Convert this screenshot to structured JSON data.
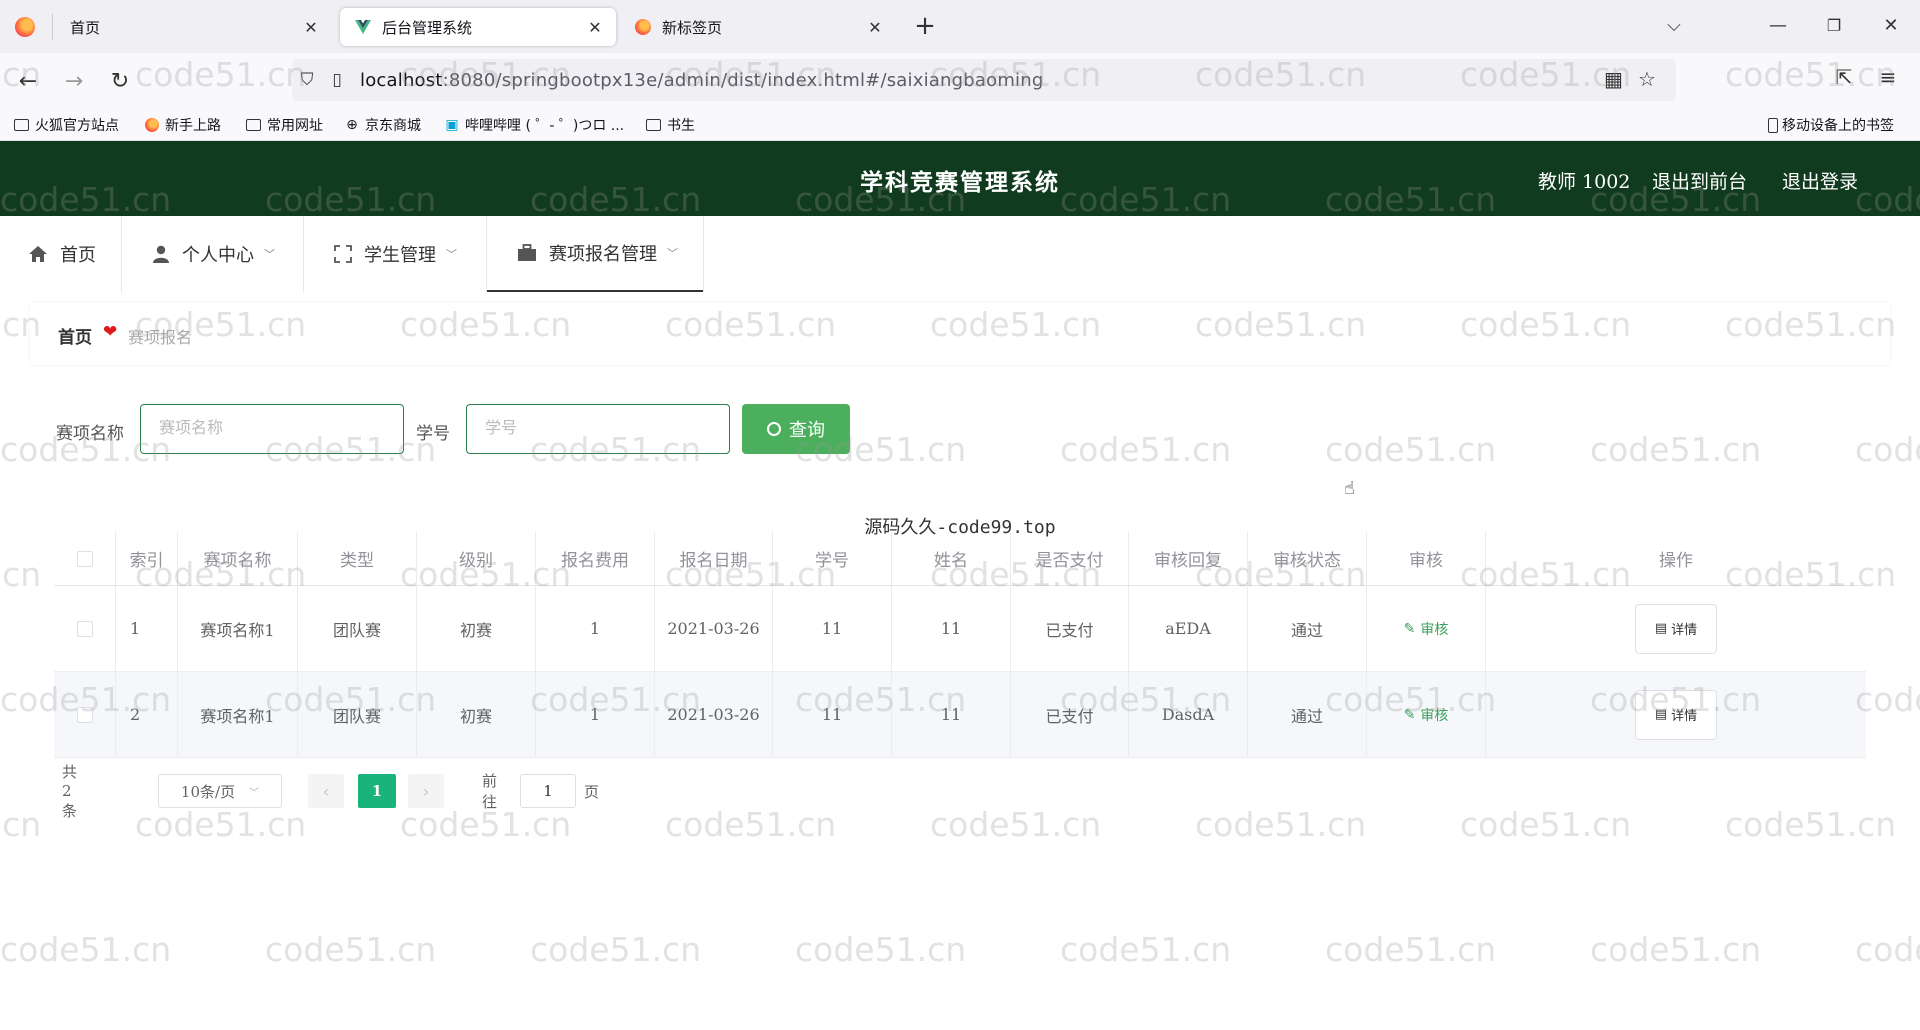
{
  "browser": {
    "tabs": [
      {
        "title": "首页",
        "close": "✕",
        "icon": "firefox-icon"
      },
      {
        "title": "后台管理系统",
        "close": "✕",
        "icon": "vue-icon"
      },
      {
        "title": "新标签页",
        "close": "✕",
        "icon": "firefox-icon"
      }
    ],
    "new_tab": "+",
    "url_host": "localhost",
    "url_rest": ":8080/springbootpx13e/admin/dist/index.html#/saixiangbaoming",
    "bookmarks": [
      {
        "label": "火狐官方站点",
        "icon": "folder-icon"
      },
      {
        "label": "新手上路",
        "icon": "firefox-icon"
      },
      {
        "label": "常用网址",
        "icon": "folder-icon"
      },
      {
        "label": "京东商城",
        "icon": "globe-icon"
      },
      {
        "label": "哔哩哔哩 ( ゜- ゜)つロ ...",
        "icon": "bilibili-icon"
      },
      {
        "label": "书生",
        "icon": "folder-icon"
      }
    ],
    "mobile_bookmarks": "移动设备上的书签"
  },
  "header": {
    "title": "学科竞赛管理系统",
    "user": "教师 1002",
    "to_front": "退出到前台",
    "logout": "退出登录"
  },
  "menu": [
    {
      "label": "首页",
      "icon": "home-icon"
    },
    {
      "label": "个人中心",
      "icon": "user-icon"
    },
    {
      "label": "学生管理",
      "icon": "frame-icon"
    },
    {
      "label": "赛项报名管理",
      "icon": "briefcase-icon"
    }
  ],
  "breadcrumb": {
    "home": "首页",
    "current": "赛项报名"
  },
  "search": {
    "name_label": "赛项名称",
    "name_placeholder": "赛项名称",
    "id_label": "学号",
    "id_placeholder": "学号",
    "button": "查询"
  },
  "table": {
    "caption": "源码久久-code99.top",
    "columns": [
      "索引",
      "赛项名称",
      "类型",
      "级别",
      "报名费用",
      "报名日期",
      "学号",
      "姓名",
      "是否支付",
      "审核回复",
      "审核状态",
      "审核",
      "操作"
    ],
    "rows": [
      [
        "1",
        "赛项名称1",
        "团队赛",
        "初赛",
        "1",
        "2021-03-26",
        "11",
        "11",
        "已支付",
        "aEDA",
        "通过"
      ],
      [
        "2",
        "赛项名称1",
        "团队赛",
        "初赛",
        "1",
        "2021-03-26",
        "11",
        "11",
        "已支付",
        "DasdA",
        "通过"
      ]
    ],
    "audit_label": "审核",
    "detail_label": "详情"
  },
  "pagination": {
    "total": "共 2 条",
    "page_size": "10条/页",
    "current": "1",
    "goto_prefix": "前往",
    "goto_value": "1",
    "goto_suffix": "页"
  },
  "watermark": "code51.cn",
  "colors": {
    "header_bg": "#113b1e",
    "accent": "#4caf5e",
    "page_active": "#18b47b"
  }
}
